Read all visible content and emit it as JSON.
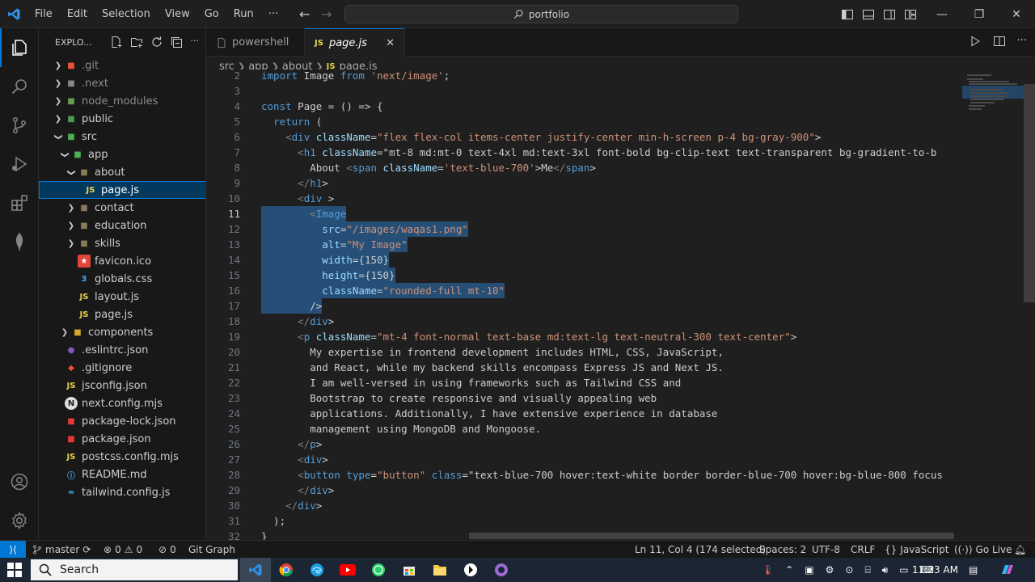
{
  "titlebar": {
    "menu": [
      "File",
      "Edit",
      "Selection",
      "View",
      "Go",
      "Run",
      "···"
    ],
    "search_text": "portfolio"
  },
  "sidebar": {
    "title": "EXPLO...",
    "items": [
      {
        "label": ".git",
        "icon": "git-folder-icon",
        "dim": true
      },
      {
        "label": ".next",
        "icon": "next-folder-icon",
        "dim": true
      },
      {
        "label": "node_modules",
        "icon": "node-folder-icon",
        "dim": true
      },
      {
        "label": "public",
        "icon": "public-folder-icon"
      },
      {
        "label": "src",
        "icon": "src-folder-icon"
      },
      {
        "label": "app",
        "icon": "app-folder-icon"
      },
      {
        "label": "about",
        "icon": "folder-icon"
      },
      {
        "label": "page.js",
        "icon": "js-file-icon",
        "selected": true
      },
      {
        "label": "contact",
        "icon": "folder-icon"
      },
      {
        "label": "education",
        "icon": "folder-icon"
      },
      {
        "label": "skills",
        "icon": "folder-icon"
      },
      {
        "label": "favicon.ico",
        "icon": "favicon-icon"
      },
      {
        "label": "globals.css",
        "icon": "css-file-icon"
      },
      {
        "label": "layout.js",
        "icon": "js-file-icon"
      },
      {
        "label": "page.js",
        "icon": "js-file-icon"
      },
      {
        "label": "components",
        "icon": "components-folder-icon"
      },
      {
        "label": ".eslintrc.json",
        "icon": "eslint-icon"
      },
      {
        "label": ".gitignore",
        "icon": "gitignore-icon"
      },
      {
        "label": "jsconfig.json",
        "icon": "js-file-icon"
      },
      {
        "label": "next.config.mjs",
        "icon": "next-icon"
      },
      {
        "label": "package-lock.json",
        "icon": "npm-icon"
      },
      {
        "label": "package.json",
        "icon": "npm-icon"
      },
      {
        "label": "postcss.config.mjs",
        "icon": "js-file-icon"
      },
      {
        "label": "README.md",
        "icon": "readme-icon"
      },
      {
        "label": "tailwind.config.js",
        "icon": "tailwind-icon"
      }
    ]
  },
  "tabs": {
    "t1": "powershell",
    "t2_badge": "JS",
    "t2": "page.js"
  },
  "breadcrumbs": {
    "p1": "src",
    "p2": "app",
    "p3": "about",
    "badge": "JS",
    "p4": "page.js"
  },
  "editor": {
    "lines": [
      {
        "n": "2",
        "t": "import Image from 'next/image';"
      },
      {
        "n": "3",
        "t": ""
      },
      {
        "n": "4",
        "t": "const Page = () => {"
      },
      {
        "n": "5",
        "t": "  return ("
      },
      {
        "n": "6",
        "t": "    <div className=\"flex flex-col items-center justify-center min-h-screen p-4 bg-gray-900\">"
      },
      {
        "n": "7",
        "t": "      <h1 className=\"mt-8 md:mt-0 text-4xl md:text-3xl font-bold bg-clip-text text-transparent bg-gradient-to-b"
      },
      {
        "n": "8",
        "t": "        About <span className='text-blue-700'>Me</span>"
      },
      {
        "n": "9",
        "t": "      </h1>"
      },
      {
        "n": "10",
        "t": "      <div >"
      },
      {
        "n": "11",
        "t": "        <Image",
        "sel": true
      },
      {
        "n": "12",
        "t": "          src=\"/images/waqas1.png\"",
        "sel": true
      },
      {
        "n": "13",
        "t": "          alt=\"My Image\"",
        "sel": true
      },
      {
        "n": "14",
        "t": "          width={150}",
        "sel": true
      },
      {
        "n": "15",
        "t": "          height={150}",
        "sel": true
      },
      {
        "n": "16",
        "t": "          className=\"rounded-full mt-10\"",
        "sel": true
      },
      {
        "n": "17",
        "t": "        />",
        "sel": true
      },
      {
        "n": "18",
        "t": "      </div>"
      },
      {
        "n": "19",
        "t": "      <p className=\"mt-4 font-normal text-base md:text-lg text-neutral-300 text-center\">"
      },
      {
        "n": "20",
        "t": "        My expertise in frontend development includes HTML, CSS, JavaScript,"
      },
      {
        "n": "21",
        "t": "        and React, while my backend skills encompass Express JS and Next JS."
      },
      {
        "n": "22",
        "t": "        I am well-versed in using frameworks such as Tailwind CSS and"
      },
      {
        "n": "23",
        "t": "        Bootstrap to create responsive and visually appealing web"
      },
      {
        "n": "24",
        "t": "        applications. Additionally, I have extensive experience in database"
      },
      {
        "n": "25",
        "t": "        management using MongoDB and Mongoose."
      },
      {
        "n": "26",
        "t": "      </p>"
      },
      {
        "n": "27",
        "t": "      <div>"
      },
      {
        "n": "28",
        "t": "      <button type=\"button\" class=\"text-blue-700 hover:text-white border border-blue-700 hover:bg-blue-800 focus"
      },
      {
        "n": "29",
        "t": "      </div>"
      },
      {
        "n": "30",
        "t": "    </div>"
      },
      {
        "n": "31",
        "t": "  );"
      },
      {
        "n": "32",
        "t": "}"
      }
    ],
    "current_line": "11"
  },
  "statusbar": {
    "branch": "master",
    "errors": "0",
    "warnings": "0",
    "ports": "0",
    "git_graph": "Git Graph",
    "position": "Ln 11, Col 4 (174 selected)",
    "spaces": "Spaces: 2",
    "encoding": "UTF-8",
    "eol": "CRLF",
    "language": "JavaScript",
    "golive": "Go Live"
  },
  "taskbar": {
    "search": "Search",
    "time": "11:23 AM"
  },
  "colors": {
    "accent": "#0078d4",
    "selection": "#264f78",
    "keyword": "#569cd6",
    "string": "#ce9178",
    "tag": "#569cd6",
    "attr": "#9cdcfe"
  }
}
